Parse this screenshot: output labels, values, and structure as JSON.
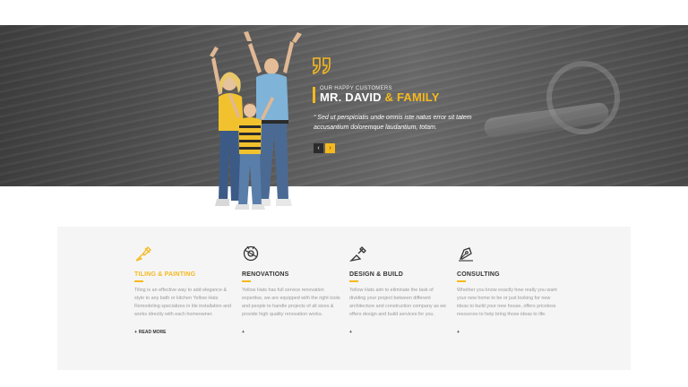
{
  "testimonial": {
    "eyebrow": "OUR HAPPY CUSTOMERS",
    "name_main": "MR. DAVID",
    "name_accent": "& FAMILY",
    "quote": "“ Sed ut perspiciatis unde omnis iste natus error sit tatem accusantium doloremque laudantium, totam.",
    "prev_icon": "‹",
    "next_icon": "›",
    "accent_color": "#f5b91e"
  },
  "services": [
    {
      "icon": "paint-brush-icon",
      "title": "TILING & PAINTING",
      "highlighted": true,
      "description": "Tiling is an effective way to add elegance & style to any bath or kitchen Yellow Hats Remodeling specializes in tile installation and works directly with each homeowner.",
      "more_label": "READ MORE",
      "more_plus": "+"
    },
    {
      "icon": "saw-blade-icon",
      "title": "RENOVATIONS",
      "highlighted": false,
      "description": "Yellow Hats has full service renovation expertise, we are equipped with the right tools and people to handle projects of all sizes & provide high quality renovation works.",
      "more_label": "",
      "more_plus": "+"
    },
    {
      "icon": "trowel-icon",
      "title": "DESIGN & BUILD",
      "highlighted": false,
      "description": "Yellow Hats aim to eliminate the task of dividing your project between different architecture and construction company as we offers design and build services for you.",
      "more_label": "",
      "more_plus": "+"
    },
    {
      "icon": "pen-nib-icon",
      "title": "CONSULTING",
      "highlighted": false,
      "description": "Whether you know exactly how really you want your new home to be or just looking for new ideas to build your new house, offers priceless resources to help bring those ideas to life.",
      "more_label": "",
      "more_plus": "+"
    }
  ]
}
